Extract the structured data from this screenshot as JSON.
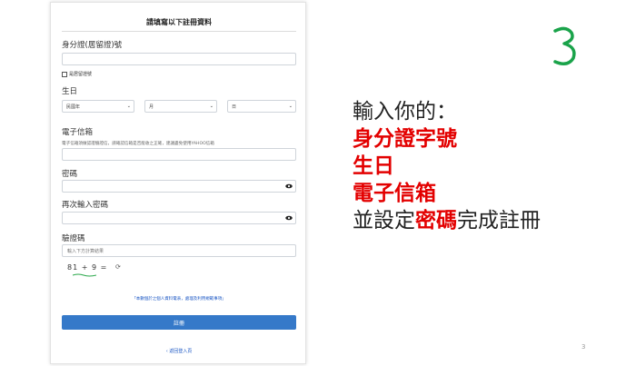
{
  "form": {
    "title": "請填寫以下註冊資料",
    "id_label": "身分證(居留證)號",
    "resident_checkbox_label": "是居留證號",
    "birthday_label": "生日",
    "birthday_year": "民國年",
    "birthday_month": "月",
    "birthday_day": "日",
    "email_label": "電子信箱",
    "email_hint": "電子信箱須做認證驗證信，請確認信箱是否能收之正確，建議盡免使用YAHOO信箱",
    "password_label": "密碼",
    "confirm_password_label": "再次輸入密碼",
    "captcha_label": "驗證碼",
    "captcha_placeholder": "輸入下方計算結果",
    "captcha_question": "81 + 9 =",
    "notice": "「本數個於之個人資料電表，處理及利用規範事項」",
    "submit_label": "註冊",
    "back_label": "‹ 返回登入頁"
  },
  "slide": {
    "step_number": "3",
    "line1": "輸入你的：",
    "line2": "身分證字號",
    "line3": "生日",
    "line4": "電子信箱",
    "line5_prefix": "並設定",
    "line5_highlight": "密碼",
    "line5_suffix": "完成註冊",
    "page_number": "3",
    "accent_color": "#e30000",
    "step_color": "#1aa34a"
  }
}
